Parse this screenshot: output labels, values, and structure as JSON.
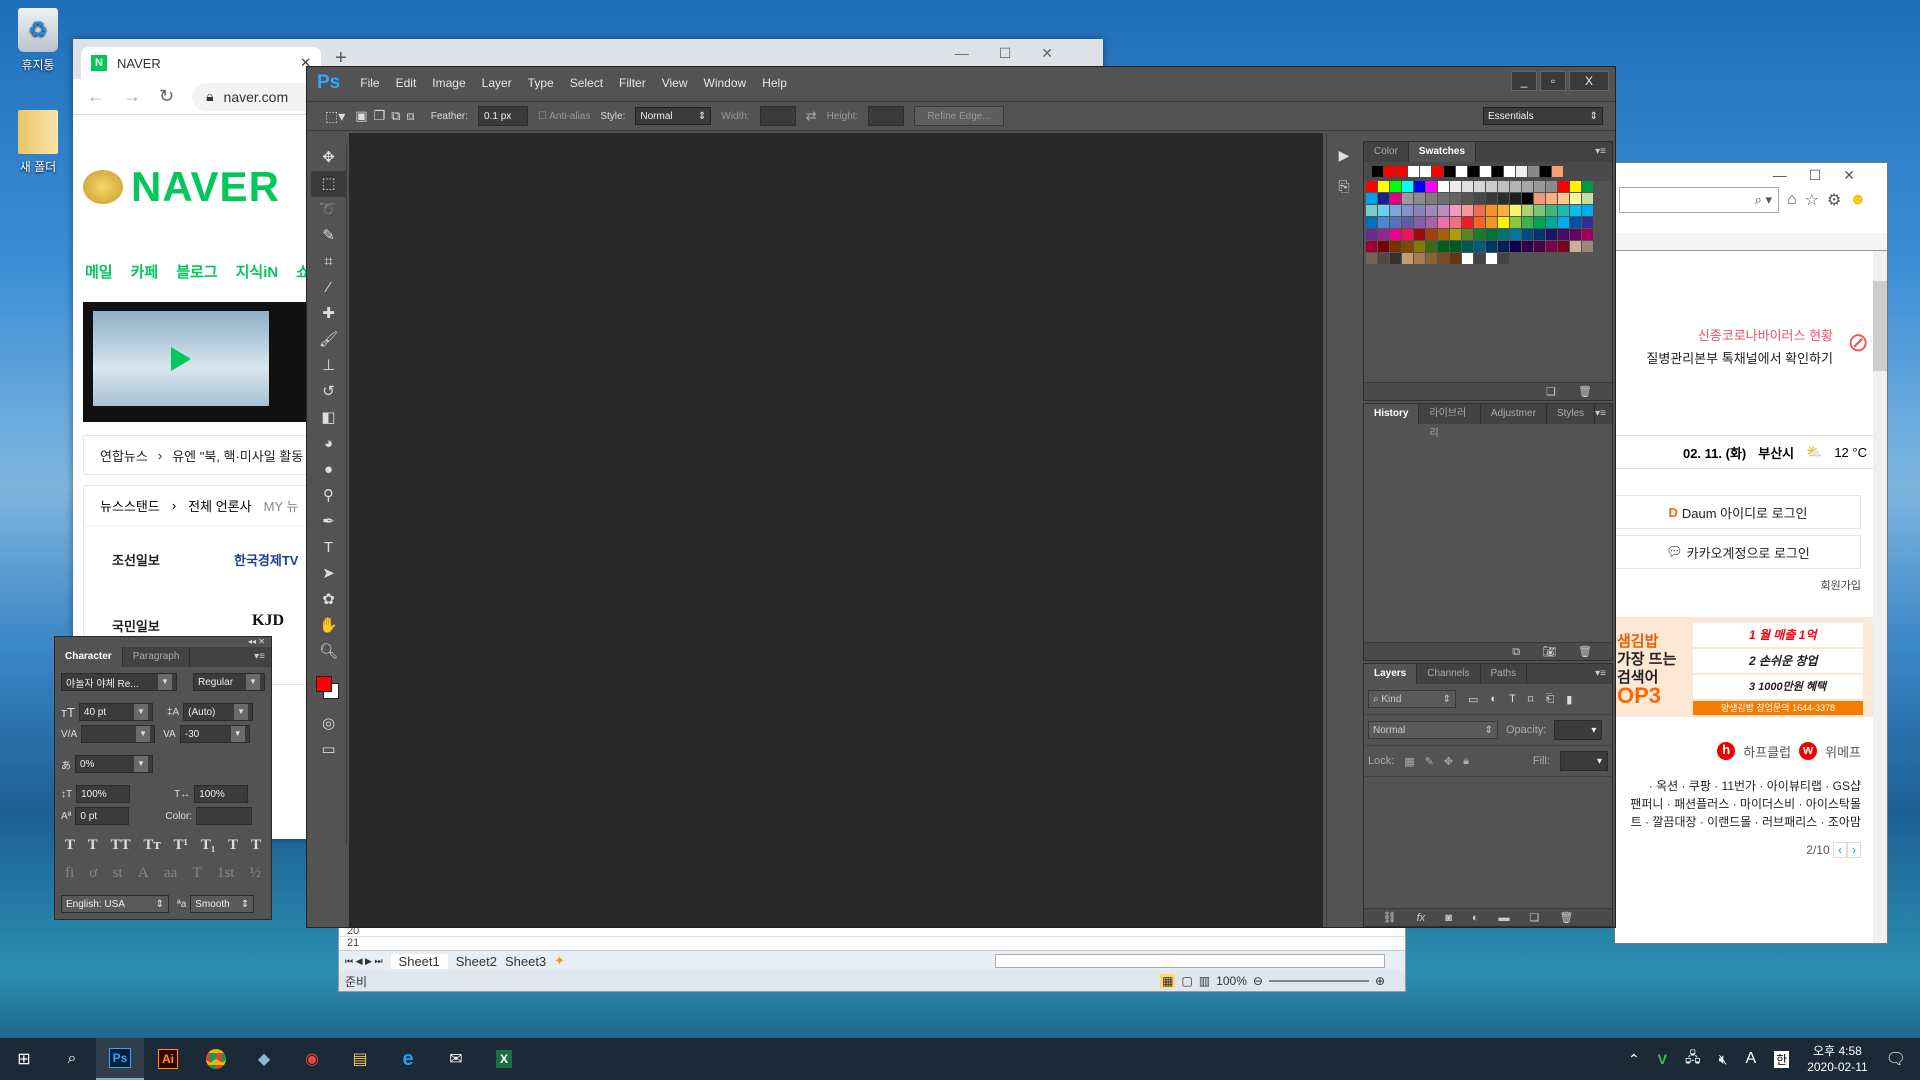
{
  "desktop": {
    "icons": [
      {
        "label": "휴지통",
        "icon": "recycle-bin-icon"
      },
      {
        "label": "새 폴더",
        "icon": "folder-icon"
      }
    ]
  },
  "chrome": {
    "tab_title": "NAVER",
    "url": "naver.com",
    "logo": "NAVER",
    "nav": [
      "메일",
      "카페",
      "블로그",
      "지식iN",
      "쇼핑"
    ],
    "news_source": "연합뉴스",
    "news_headline": "유엔 \"북, 핵·미사일 활동",
    "newsstand": "뉴스스탠드",
    "all_press": "전체 언론사",
    "my_news": "MY 뉴",
    "press": [
      "조선일보",
      "한국경제TV",
      "국민일보",
      "KJD"
    ]
  },
  "ie": {
    "corona_title": "신종코로나바이러스 현황",
    "corona_sub": "질병관리본부 톡채널에서 확인하기",
    "date": "02. 11. (화)",
    "city": "부산시",
    "temp": "12 °C",
    "daum_login": "Daum 아이디로 로그인",
    "kakao_login": "카카오계정으로 로그인",
    "signup": "회원가입",
    "ad": {
      "brand": "샘김밥",
      "line1": "가장 뜨는",
      "line2": "검색어",
      "top": "OP3",
      "items": [
        "1 월 매출 1억",
        "2 손쉬운 창업",
        "3 1000만원 혜택"
      ],
      "phone": "양생김밥 창업문의 1644-3378"
    },
    "links_row": [
      "하프클럽",
      "위메프"
    ],
    "shops": [
      "· 옥션 · 쿠팡 · 11번가 · 아이뷰티랩 · GS샵",
      "팬퍼니 · 패션플러스 · 마이더스비 · 아이스탁몰",
      "트 · 깔끔대장 · 이랜드몰 · 러브패리스 · 조아맘"
    ],
    "page": "2/10"
  },
  "excel": {
    "rows": [
      "20",
      "21"
    ],
    "sheets": [
      "Sheet1",
      "Sheet2",
      "Sheet3"
    ],
    "status": "준비",
    "zoom": "100%"
  },
  "ps": {
    "logo": "Ps",
    "menu": [
      "File",
      "Edit",
      "Image",
      "Layer",
      "Type",
      "Select",
      "Filter",
      "View",
      "Window",
      "Help"
    ],
    "options": {
      "feather_label": "Feather:",
      "feather": "0.1 px",
      "antialias": "Anti-alias",
      "style_label": "Style:",
      "style": "Normal",
      "width_label": "Width:",
      "height_label": "Height:",
      "refine": "Refine Edge...",
      "workspace": "Essentials"
    },
    "tools": [
      "move",
      "marquee",
      "lasso",
      "quick-select",
      "crop",
      "eyedropper",
      "healing",
      "brush",
      "stamp",
      "history-brush",
      "eraser",
      "bucket",
      "blur",
      "dodge",
      "pen",
      "type",
      "path-select",
      "shape",
      "hand",
      "zoom"
    ],
    "panels": {
      "swatch_tabs": [
        "Color",
        "Swatches"
      ],
      "history_tabs": [
        "History",
        "라이브러리",
        "Adjustmer",
        "Styles"
      ],
      "layer_tabs": [
        "Layers",
        "Channels",
        "Paths"
      ],
      "kind": "Kind",
      "blend": "Normal",
      "opacity_label": "Opacity:",
      "lock_label": "Lock:",
      "fill_label": "Fill:"
    },
    "swatches_recent": [
      "#000000",
      "#ff0000",
      "#ff0000",
      "#ffffff",
      "#ffffff",
      "#ff0000",
      "#000000",
      "#ffffff",
      "#000000",
      "#ffffff",
      "#000000",
      "#ffffff",
      "#eeeeee",
      "#888888",
      "#000000",
      "#fb9e78"
    ],
    "swatches": [
      "#ff0000",
      "#ffff00",
      "#00ff00",
      "#00ffff",
      "#0000ff",
      "#ff00ff",
      "#ffffff",
      "#ebebeb",
      "#e0e0e0",
      "#d6d6d6",
      "#cccccc",
      "#c0c0c0",
      "#b3b3b3",
      "#a6a6a6",
      "#999999",
      "#8c8c8c",
      "#ff0000",
      "#fff200",
      "#009944",
      "#00a0e9",
      "#1d2088",
      "#e4007f",
      "#999999",
      "#8a8a8a",
      "#7d7d7d",
      "#6f6f6f",
      "#626262",
      "#555555",
      "#474747",
      "#3a3a3a",
      "#2d2d2d",
      "#1f1f1f",
      "#000000",
      "#f69679",
      "#f9ad81",
      "#fdc68a",
      "#fff799",
      "#c4df9b",
      "#7accc8",
      "#6dcff6",
      "#7da7d9",
      "#8393ca",
      "#8781bd",
      "#a187be",
      "#bc8dbf",
      "#f49ac1",
      "#f5989d",
      "#f26c4f",
      "#f7941d",
      "#fbaf3f",
      "#fff568",
      "#acd373",
      "#7cc576",
      "#3bb878",
      "#1abbb4",
      "#00bff3",
      "#00aeef",
      "#0072bc",
      "#448ccb",
      "#5574b9",
      "#605ca8",
      "#855fa8",
      "#a763a8",
      "#f06eaa",
      "#f26d7d",
      "#ed1c24",
      "#f26522",
      "#f7941d",
      "#fff200",
      "#8dc63f",
      "#39b54a",
      "#00a651",
      "#00a99d",
      "#00aeef",
      "#0054a6",
      "#2e3192",
      "#662d91",
      "#92278f",
      "#ec008c",
      "#ed145b",
      "#9e0b0f",
      "#a0410d",
      "#a36209",
      "#aba000",
      "#598527",
      "#197b30",
      "#007236",
      "#00746b",
      "#0076a3",
      "#004a80",
      "#003471",
      "#1b1464",
      "#440e62",
      "#630460",
      "#9e005d",
      "#9e0039",
      "#790000",
      "#7b2e00",
      "#7d4900",
      "#827b00",
      "#406618",
      "#005e20",
      "#005826",
      "#005952",
      "#005b7f",
      "#003663",
      "#002157",
      "#0d004c",
      "#32004b",
      "#4b0049",
      "#7b0046",
      "#7a0026",
      "#c7b299",
      "#998675",
      "#736357",
      "#534741",
      "#362f2d",
      "#c69c6d",
      "#a67c52",
      "#8c6239",
      "#754c24",
      "#603913",
      "#ffffff",
      "#444444",
      "#ffffff",
      "#444444"
    ],
    "fg_color": "#ff0000",
    "bg_color": "#ffffff"
  },
  "character": {
    "tabs": [
      "Character",
      "Paragraph"
    ],
    "font": "야놀자 야체 Re...",
    "style": "Regular",
    "size": "40 pt",
    "leading": "(Auto)",
    "kerning": "",
    "tracking": "-30",
    "tsume": "0%",
    "vscale": "100%",
    "hscale": "100%",
    "baseline": "0 pt",
    "color_label": "Color:",
    "glyphs1": [
      "T",
      "T",
      "TT",
      "Tт",
      "T¹",
      "T₁",
      "T",
      "T"
    ],
    "glyphs2": [
      "fi",
      "ơ",
      "st",
      "A",
      "aa",
      "T",
      "1st",
      "½"
    ],
    "language": "English: USA",
    "aa_label": "ªa",
    "antialias": "Smooth"
  },
  "taskbar": {
    "apps": [
      "Photoshop",
      "Illustrator",
      "Chrome",
      "App",
      "App",
      "Explorer",
      "Internet Explorer",
      "Mail",
      "Excel"
    ],
    "time": "오후 4:58",
    "date": "2020-02-11",
    "ime": "한",
    "lang": "A"
  }
}
